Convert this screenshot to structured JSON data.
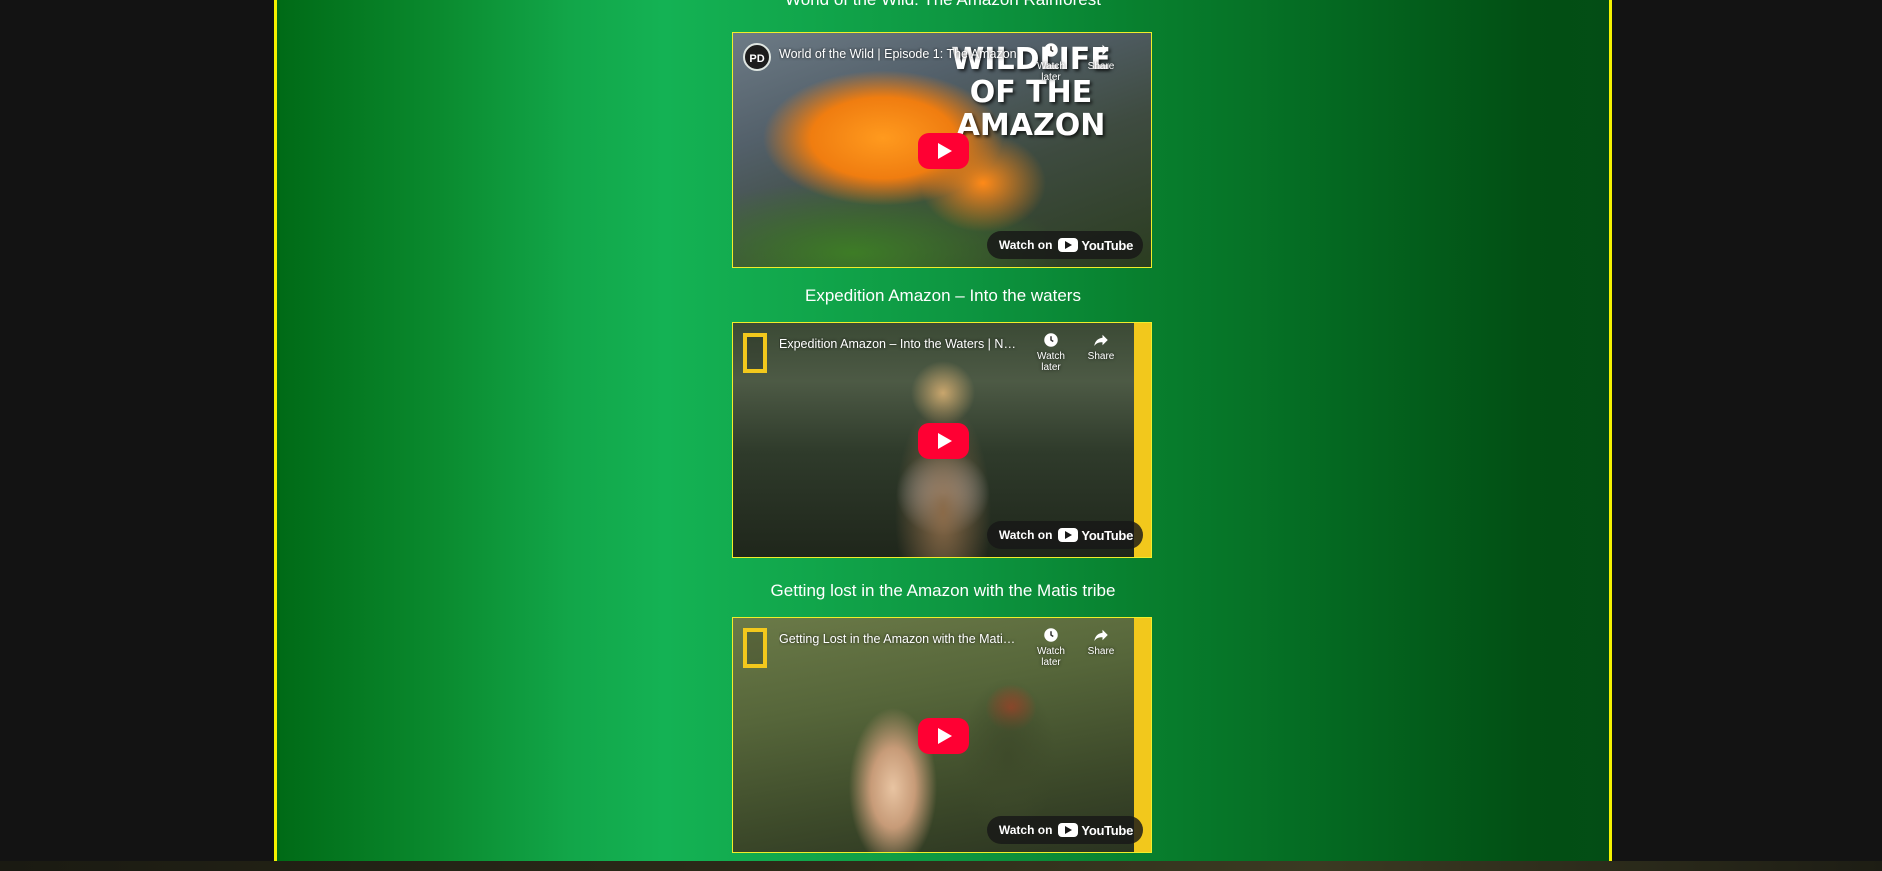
{
  "videos": [
    {
      "heading": "World of the Wild: The Amazon Rainforest",
      "overlay_title": "World of the Wild | Episode 1: The Amazon",
      "channel_badge": "PD",
      "thumb_text": [
        "WILDLIFE",
        "OF THE",
        "AMAZON"
      ],
      "watch_later": "Watch later",
      "share": "Share",
      "watch_on": "Watch on",
      "youtube": "YouTube"
    },
    {
      "heading": "Expedition Amazon – Into the waters",
      "overlay_title": "Expedition Amazon – Into the Waters | National Geographic",
      "watch_later": "Watch later",
      "share": "Share",
      "watch_on": "Watch on",
      "youtube": "YouTube"
    },
    {
      "heading": "Getting lost in the Amazon with the Matis tribe",
      "overlay_title": "Getting Lost in the Amazon with the Matis Tribe",
      "watch_later": "Watch later",
      "share": "Share",
      "watch_on": "Watch on",
      "youtube": "YouTube"
    }
  ],
  "colors": {
    "panel_border": "#f4f200",
    "play_button": "#ff0033",
    "natgeo_yellow": "#f2c81c"
  },
  "icons": [
    "clock-icon",
    "share-icon",
    "play-icon",
    "youtube-logo-icon"
  ]
}
